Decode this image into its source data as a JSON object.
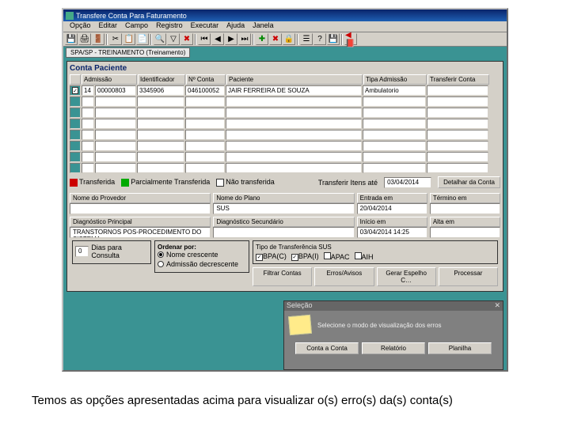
{
  "window": {
    "title": "Transfere Conta Para Faturamento"
  },
  "menu": [
    "Opção",
    "Editar",
    "Campo",
    "Registro",
    "Executar",
    "Ajuda",
    "Janela"
  ],
  "subtab": "SPA/SP - TREINAMENTO (Treinamento)",
  "panel": {
    "title": "Conta Paciente"
  },
  "grid": {
    "headers": [
      "Admissão",
      "Identificador",
      "Nº Conta",
      "Paciente",
      "Tipa Admissão",
      "Transferir Conta"
    ],
    "row": {
      "c0": "14",
      "c1": "00000803",
      "c2": "3345906",
      "c3": "046100052",
      "c4": "JAIR FERREIRA DE SOUZA",
      "c5": "Ambulatorio"
    }
  },
  "legend": {
    "l1": "Transferida",
    "l2": "Parcialmente Transferida",
    "l3": "Não transferida",
    "l4": "Transferir Itens até",
    "date": "03/04/2014",
    "btn": "Detalhar da Conta"
  },
  "fields": {
    "prov_label": "Nome do Provedor",
    "plano_label": "Nome do Plano",
    "plano_val": "SUS",
    "ent_label": "Entrada em",
    "ent_val": "20/04/2014",
    "term_label": "Término em",
    "diag1_label": "Diagnóstico Principal",
    "diag1_val": "TRANSTORNOS POS-PROCEDIMENTO DO SISTEMA",
    "diag2_label": "Diagnóstico Secundário",
    "ini_label": "Início em",
    "ini_val": "03/04/2014 14:25",
    "alta_label": "Alta em"
  },
  "options": {
    "dias_chk": "0",
    "dias_label": "Dias para Consulta",
    "ord_label": "Ordenar por:",
    "r1": "Nome crescente",
    "r2": "Admissão decrescente",
    "tr_label": "Tipo de Transferência SUS",
    "t1": "BPA(C)",
    "t2": "BPA(I)",
    "t3": "APAC",
    "t4": "AIH"
  },
  "buttons": {
    "b1": "Filtrar Contas",
    "b2": "Erros/Avisos",
    "b3": "Gerar Espelho C…",
    "b4": "Processar"
  },
  "popup": {
    "title": "Seleção",
    "text": "Selecione o modo de visualização dos erros",
    "b1": "Conta a Conta",
    "b2": "Relatório",
    "b3": "Planilha"
  },
  "caption": "Temos as opções apresentadas acima para visualizar o(s) erro(s) da(s) conta(s)"
}
